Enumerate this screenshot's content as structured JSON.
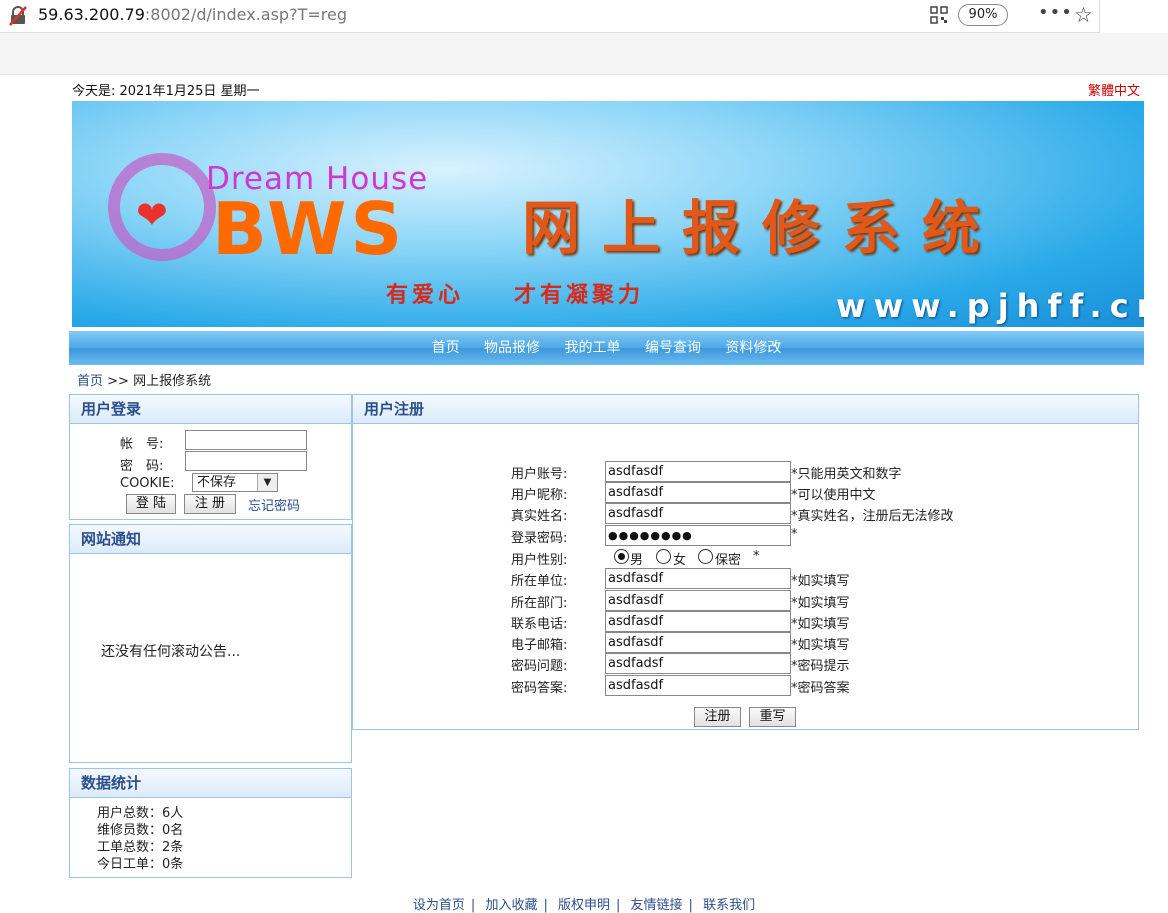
{
  "browser": {
    "url_host": "59.63.200.79",
    "url_rest": ":8002/d/index.asp?T=reg",
    "zoom": "90%"
  },
  "header": {
    "date": "今天是: 2021年1月25日 星期一",
    "traditional_link": "繁體中文"
  },
  "banner": {
    "brand_top": "Dream House",
    "brand_main": "BWS",
    "title": "网上报修系统",
    "slogan_left": "有爱心",
    "slogan_right": "才有凝聚力",
    "site": "www.pjhff.cn"
  },
  "nav": [
    "首页",
    "物品报修",
    "我的工单",
    "编号查询",
    "资料修改"
  ],
  "breadcrumb": {
    "home": "首页",
    "separator": ">>",
    "current": "网上报修系统"
  },
  "login": {
    "title": "用户登录",
    "account_label": "帐　号:",
    "password_label": "密　码:",
    "cookie_label": "COOKIE:",
    "cookie_value": "不保存",
    "login_button": "登 陆",
    "register_button": "注 册",
    "forgot_link": "忘记密码"
  },
  "notice": {
    "title": "网站通知",
    "text": "还没有任何滚动公告..."
  },
  "stats": {
    "title": "数据统计",
    "lines": [
      "用户总数：6人",
      "维修员数：0名",
      "工单总数：2条",
      "今日工单：0条"
    ]
  },
  "register": {
    "title": "用户注册",
    "rows": [
      {
        "label": "用户账号:",
        "value": "asdfasdf",
        "hint": "*只能用英文和数字"
      },
      {
        "label": "用户昵称:",
        "value": "asdfasdf",
        "hint": "*可以使用中文"
      },
      {
        "label": "真实姓名:",
        "value": "asdfasdf",
        "hint": "*真实姓名，注册后无法修改"
      },
      {
        "label": "登录密码:",
        "value": "●●●●●●●●",
        "hint": "*"
      },
      {
        "label": "所在单位:",
        "value": "asdfasdf",
        "hint": "*如实填写"
      },
      {
        "label": "所在部门:",
        "value": "asdfasdf",
        "hint": "*如实填写"
      },
      {
        "label": "联系电话:",
        "value": "asdfasdf",
        "hint": "*如实填写"
      },
      {
        "label": "电子邮箱:",
        "value": "asdfasdf",
        "hint": "*如实填写"
      },
      {
        "label": "密码问题:",
        "value": "asdfadsf",
        "hint": "*密码提示"
      },
      {
        "label": "密码答案:",
        "value": "asdfasdf",
        "hint": "*密码答案"
      }
    ],
    "gender_label": "用户性别:",
    "gender_options": [
      "男",
      "女",
      "保密"
    ],
    "gender_selected": "男",
    "gender_required": "*",
    "submit_button": "注册",
    "reset_button": "重写"
  },
  "footer": [
    "设为首页",
    "加入收藏",
    "版权申明",
    "友情链接",
    "联系我们"
  ]
}
